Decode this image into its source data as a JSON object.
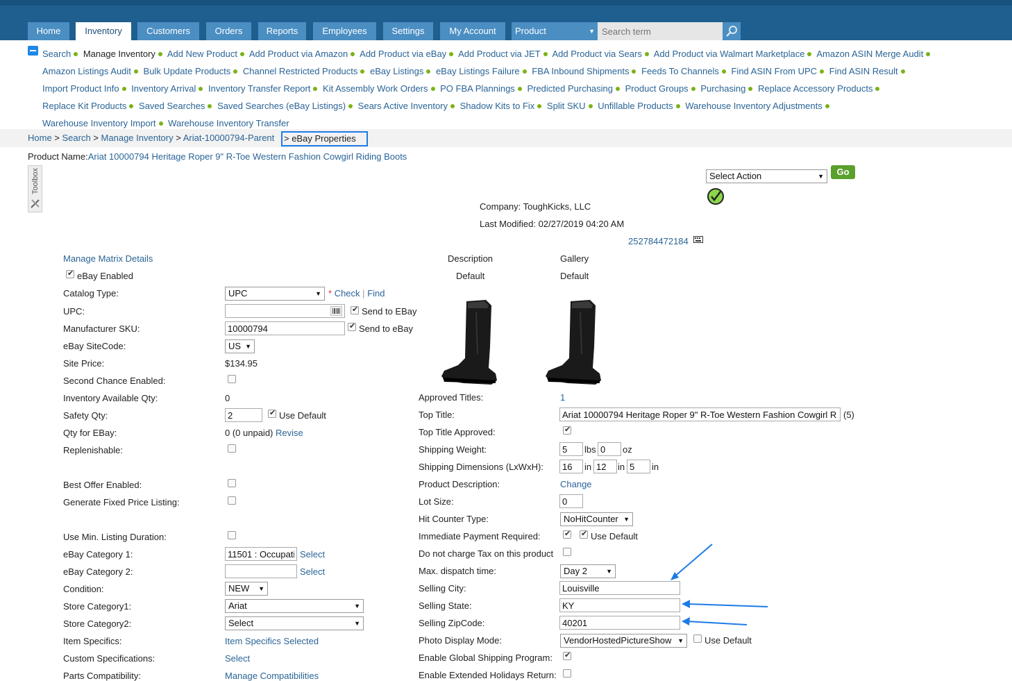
{
  "nav": {
    "tabs": [
      "Home",
      "Inventory",
      "Customers",
      "Orders",
      "Reports",
      "Employees",
      "Settings",
      "My Account"
    ],
    "search_scope": "Product",
    "search_placeholder": "Search term"
  },
  "submenu": {
    "current": "Manage Inventory",
    "items": [
      "Search",
      "Manage Inventory",
      "Add New Product",
      "Add Product via Amazon",
      "Add Product via eBay",
      "Add Product via JET",
      "Add Product via Sears",
      "Add Product via Walmart Marketplace",
      "Amazon ASIN Merge Audit",
      "Amazon Listings Audit",
      "Bulk Update Products",
      "Channel Restricted Products",
      "eBay Listings",
      "eBay Listings Failure",
      "FBA Inbound Shipments",
      "Feeds To Channels",
      "Find ASIN From UPC",
      "Find ASIN Result",
      "Import Product Info",
      "Inventory Arrival",
      "Inventory Transfer Report",
      "Kit Assembly Work Orders",
      "PO FBA Plannings",
      "Predicted Purchasing",
      "Product Groups",
      "Purchasing",
      "Replace Accessory Products",
      "Replace Kit Products",
      "Saved Searches",
      "Saved Searches (eBay Listings)",
      "Sears Active Inventory",
      "Shadow Kits to Fix",
      "Split SKU",
      "Unfillable Products",
      "Warehouse Inventory Adjustments",
      "Warehouse Inventory Import",
      "Warehouse Inventory Transfer"
    ]
  },
  "breadcrumb": {
    "home": "Home",
    "search": "Search",
    "manage": "Manage Inventory",
    "parent": "Ariat-10000794-Parent",
    "current": "> eBay Properties",
    "sep": " > "
  },
  "product": {
    "label": "Product Name:",
    "name": "Ariat 10000794 Heritage Roper 9\" R-Toe Western Fashion Cowgirl Riding Boots"
  },
  "toolbox": "Toolbox",
  "action": {
    "select": "Select Action",
    "go": "Go"
  },
  "company": {
    "label": "Company:",
    "value": "ToughKicks, LLC"
  },
  "modified": {
    "label": "Last Modified:",
    "value": "02/27/2019 04:20 AM"
  },
  "listing_id": "252784472184",
  "left": {
    "manage_matrix": "Manage Matrix Details",
    "ebay_enabled": "eBay Enabled",
    "catalog_type": {
      "label": "Catalog Type:",
      "value": "UPC",
      "check": "Check",
      "sep": "|",
      "find": "Find"
    },
    "upc": {
      "label": "UPC:",
      "value": "",
      "send": "Send to EBay"
    },
    "mfr_sku": {
      "label": "Manufacturer SKU:",
      "value": "10000794",
      "send": "Send to eBay"
    },
    "site_code": {
      "label": "eBay SiteCode:",
      "value": "US"
    },
    "site_price": {
      "label": "Site Price:",
      "value": "$134.95"
    },
    "second_chance": {
      "label": "Second Chance Enabled:"
    },
    "inv_qty": {
      "label": "Inventory Available Qty:",
      "value": "0"
    },
    "safety_qty": {
      "label": "Safety Qty:",
      "value": "2",
      "use_default": "Use Default"
    },
    "qty_ebay": {
      "label": "Qty for EBay:",
      "value": "0 (0 unpaid)",
      "revise": "Revise"
    },
    "replenishable": {
      "label": "Replenishable:"
    },
    "best_offer": {
      "label": "Best Offer Enabled:"
    },
    "fixed_price": {
      "label": "Generate Fixed Price Listing:"
    },
    "min_duration": {
      "label": "Use Min. Listing Duration:"
    },
    "cat1": {
      "label": "eBay Category 1:",
      "value": "11501 : Occupati",
      "select": "Select"
    },
    "cat2": {
      "label": "eBay Category 2:",
      "value": "",
      "select": "Select"
    },
    "condition": {
      "label": "Condition:",
      "value": "NEW"
    },
    "store_cat1": {
      "label": "Store Category1:",
      "value": "Ariat"
    },
    "store_cat2": {
      "label": "Store Category2:",
      "value": "Select"
    },
    "item_specifics": {
      "label": "Item Specifics:",
      "value": "Item Specifics Selected"
    },
    "custom_specs": {
      "label": "Custom Specifications:",
      "value": "Select"
    },
    "parts": {
      "label": "Parts Compatibility:",
      "value": "Manage Compatibilities"
    }
  },
  "images": {
    "description": {
      "title": "Description",
      "sub": "Default"
    },
    "gallery": {
      "title": "Gallery",
      "sub": "Default"
    }
  },
  "right": {
    "approved_titles": {
      "label": "Approved Titles:",
      "value": "1"
    },
    "top_title": {
      "label": "Top Title:",
      "value": "Ariat 10000794 Heritage Roper 9\" R-Toe Western Fashion Cowgirl R",
      "count": "(5)"
    },
    "top_title_approved": {
      "label": "Top Title Approved:"
    },
    "ship_weight": {
      "label": "Shipping Weight:",
      "lbs": "5",
      "lbs_unit": "lbs",
      "oz": "0",
      "oz_unit": "oz"
    },
    "ship_dims": {
      "label": "Shipping Dimensions (LxWxH):",
      "l": "16",
      "w": "12",
      "h": "5",
      "unit": "in"
    },
    "prod_desc": {
      "label": "Product Description:",
      "value": "Change"
    },
    "lot_size": {
      "label": "Lot Size:",
      "value": "0"
    },
    "hit_counter": {
      "label": "Hit Counter Type:",
      "value": "NoHitCounter"
    },
    "immediate_pay": {
      "label": "Immediate Payment Required:",
      "use_default": "Use Default"
    },
    "no_tax": {
      "label": "Do not charge Tax on this product"
    },
    "dispatch": {
      "label": "Max. dispatch time:",
      "value": "Day 2"
    },
    "city": {
      "label": "Selling City:",
      "value": "Louisville"
    },
    "state": {
      "label": "Selling State:",
      "value": "KY"
    },
    "zip": {
      "label": "Selling ZipCode:",
      "value": "40201"
    },
    "photo_mode": {
      "label": "Photo Display Mode:",
      "value": "VendorHostedPictureShow",
      "use_default": "Use Default"
    },
    "global_ship": {
      "label": "Enable Global Shipping Program:"
    },
    "holidays": {
      "label": "Enable Extended Holidays Return:"
    }
  },
  "colors": {
    "nav_bg": "#1f5f8f",
    "tab_bg": "#4a8ec2",
    "link": "#2a6496",
    "bullet": "#7ab317",
    "annotation": "#1e7be5",
    "go_btn": "#5aa02c"
  },
  "icons": [
    "search-icon",
    "collapse-icon",
    "toolbox-icon",
    "checkmark-icon",
    "barcode-icon",
    "keyboard-icon",
    "boot-image",
    "annotation-arrow"
  ]
}
